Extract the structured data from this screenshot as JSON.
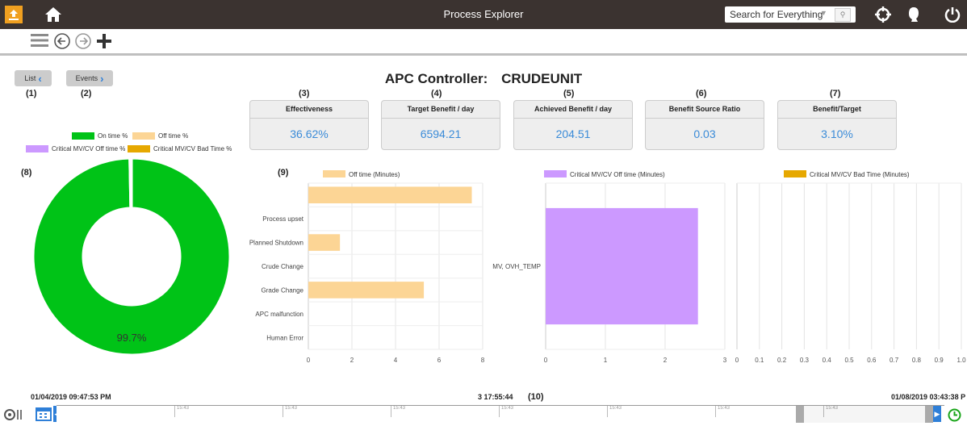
{
  "app": {
    "title": "Process Explorer",
    "search_placeholder": "Search for Everything"
  },
  "icons": {
    "upload": "upload-icon",
    "home": "home-icon",
    "menu": "menu-icon",
    "back": "back-arrow-icon",
    "forward": "forward-arrow-icon",
    "add": "plus-icon",
    "target": "crosshair-icon",
    "user": "user-icon",
    "power": "power-icon",
    "calendar": "calendar-icon",
    "clock": "clock-icon"
  },
  "page": {
    "heading_prefix": "APC Controller:",
    "heading_name": "CRUDEUNIT"
  },
  "nav": {
    "list_label": "List",
    "events_label": "Events"
  },
  "tags": [
    "(1)",
    "(2)",
    "(3)",
    "(4)",
    "(5)",
    "(6)",
    "(7)",
    "(8)",
    "(9)",
    "(10)"
  ],
  "kpis": [
    {
      "label": "Effectiveness",
      "value": "36.62%"
    },
    {
      "label": "Target Benefit / day",
      "value": "6594.21"
    },
    {
      "label": "Achieved Benefit / day",
      "value": "204.51"
    },
    {
      "label": "Benefit Source Ratio",
      "value": "0.03"
    },
    {
      "label": "Benefit/Target",
      "value": "3.10%"
    }
  ],
  "colors": {
    "on_time": "#00c317",
    "off_time": "#fcd595",
    "critical_off": "#cc99ff",
    "critical_bad": "#e6a800",
    "kpi_value": "#3a8bd8",
    "topbar": "#3b3330"
  },
  "timeline": {
    "start": "01/04/2019 09:47:53 PM",
    "duration": "3 17:55:44",
    "end": "01/08/2019 03:43:38 P",
    "tick_label": "15:43"
  },
  "chart_data": [
    {
      "type": "pie",
      "variant": "donut",
      "legend": [
        "On time %",
        "Off time %",
        "Critical MV/CV Off time %",
        "Critical MV/CV Bad Time %"
      ],
      "values": [
        99.7,
        0.3,
        0,
        0
      ],
      "data_label": "99.7%"
    },
    {
      "type": "bar",
      "orientation": "horizontal",
      "series_name": "Off time (Minutes)",
      "categories": [
        "",
        "Process upset",
        "Planned Shutdown",
        "Crude Change",
        "Grade Change",
        "APC malfunction",
        "Human Error"
      ],
      "values": [
        7.5,
        0,
        1.45,
        0,
        5.3,
        0,
        0
      ],
      "xlim": [
        0,
        8
      ],
      "xticks": [
        "0",
        "2",
        "4",
        "6",
        "8"
      ]
    },
    {
      "type": "bar",
      "orientation": "horizontal",
      "series_name": "Critical MV/CV Off time (Minutes)",
      "categories": [
        "MV, OVH_TEMP"
      ],
      "values": [
        2.55
      ],
      "xlim": [
        0,
        3
      ],
      "xticks": [
        "0",
        "1",
        "2",
        "3"
      ]
    },
    {
      "type": "bar",
      "orientation": "horizontal",
      "series_name": "Critical MV/CV Bad Time (Minutes)",
      "categories": [],
      "values": [],
      "xlim": [
        0,
        1.0
      ],
      "xticks": [
        "0",
        "0.1",
        "0.2",
        "0.3",
        "0.4",
        "0.5",
        "0.6",
        "0.7",
        "0.8",
        "0.9",
        "1.0"
      ]
    }
  ]
}
